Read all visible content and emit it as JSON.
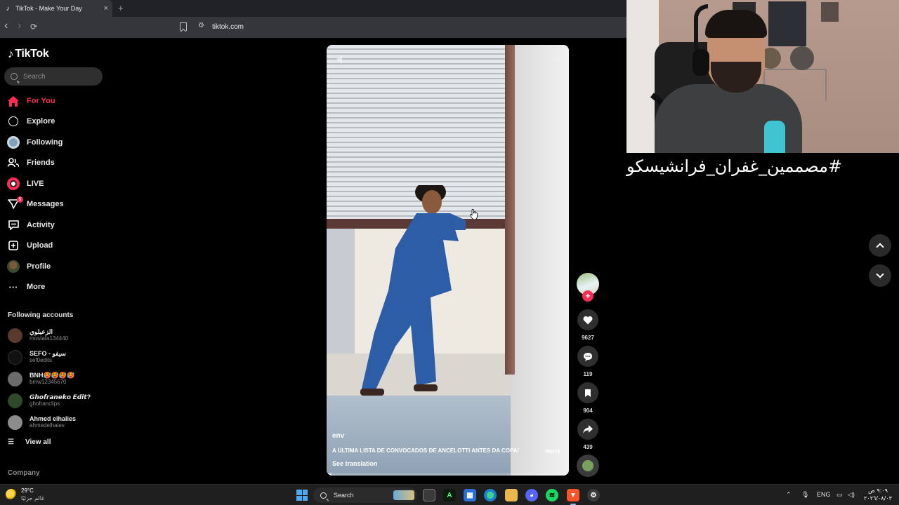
{
  "browser": {
    "tab_title": "TikTok - Make Your Day",
    "tab_close": "×",
    "new_tab": "+",
    "back": "‹",
    "forward": "›",
    "reload": "⟳",
    "site_info": "⚙",
    "url": "tiktok.com"
  },
  "sidebar": {
    "logo_text": "TikTok",
    "search_placeholder": "Search",
    "nav": [
      {
        "label": "For You",
        "icon": "home-icon",
        "active": true
      },
      {
        "label": "Explore",
        "icon": "compass-icon"
      },
      {
        "label": "Following",
        "icon": "following-avatar-icon"
      },
      {
        "label": "Friends",
        "icon": "friends-icon"
      },
      {
        "label": "LIVE",
        "icon": "live-icon"
      },
      {
        "label": "Messages",
        "icon": "messages-icon",
        "badge": "5"
      },
      {
        "label": "Activity",
        "icon": "activity-icon"
      },
      {
        "label": "Upload",
        "icon": "upload-icon"
      },
      {
        "label": "Profile",
        "icon": "profile-avatar-icon"
      },
      {
        "label": "More",
        "icon": "more-icon"
      }
    ],
    "following_title": "Following accounts",
    "accounts": [
      {
        "name": "الزعبلوي",
        "handle": "mostafa134440",
        "color": "#5b3a2e"
      },
      {
        "name": "SEFO - سيفو",
        "handle": "sef0edits",
        "color": "#111111"
      },
      {
        "name": "BNH🥵🥵🥵🥵",
        "handle": "bmw12345670",
        "color": "#6b6b6b"
      },
      {
        "name": "𝙂𝙝𝙤𝙛𝙧𝙖𝙣𝙚𝙠𝙤 𝙀𝙙𝙞𝙩?",
        "handle": "ghofranclips",
        "color": "#2f4a2a"
      },
      {
        "name": "Ahmed elhalies",
        "handle": "ahmedelhaies",
        "color": "#8c8c8c"
      }
    ],
    "view_all": "View all",
    "company": "Company"
  },
  "video": {
    "username": "env",
    "caption": "A ÚLTIMA LISTA DE CONVOCADOS DE ANCELOTTI ANTES DA COPA!",
    "more": "more",
    "see_translation": "See translation",
    "progress": 0.02,
    "options": "···"
  },
  "actions": {
    "follow": "+",
    "likes": "9627",
    "comments": "119",
    "saves": "904",
    "shares": "439"
  },
  "overlay": {
    "hashtag": "#مصممين_غفران_فرانشيسكو"
  },
  "taskbar": {
    "temperature": "29°C",
    "weather": "غالم جزئيًا",
    "search": "Search",
    "language": "ENG",
    "time": "٩:٠٩ ص",
    "date": "٢٠٢٦/٠٨/٠٣"
  },
  "colors": {
    "accent": "#fe2c55",
    "background": "#000000"
  }
}
